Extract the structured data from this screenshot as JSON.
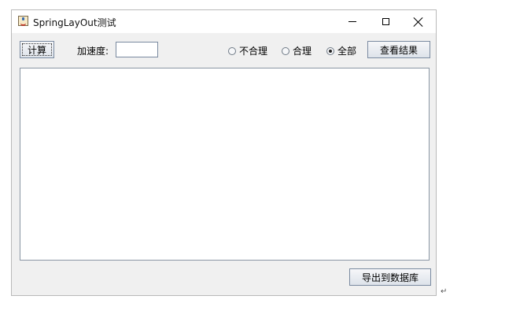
{
  "window": {
    "title": "SpringLayOut测试",
    "controls": {
      "minimize": "–",
      "maximize": "☐",
      "close": "✕"
    }
  },
  "toolbar": {
    "calc_button": "计算",
    "accel_label": "加速度:",
    "accel_value": "",
    "radios": [
      {
        "label": "不合理",
        "checked": false
      },
      {
        "label": "合理",
        "checked": false
      },
      {
        "label": "全部",
        "checked": true
      }
    ],
    "view_result_button": "查看结果"
  },
  "footer": {
    "export_button": "导出到数据库"
  },
  "paragraph_mark": "↵"
}
